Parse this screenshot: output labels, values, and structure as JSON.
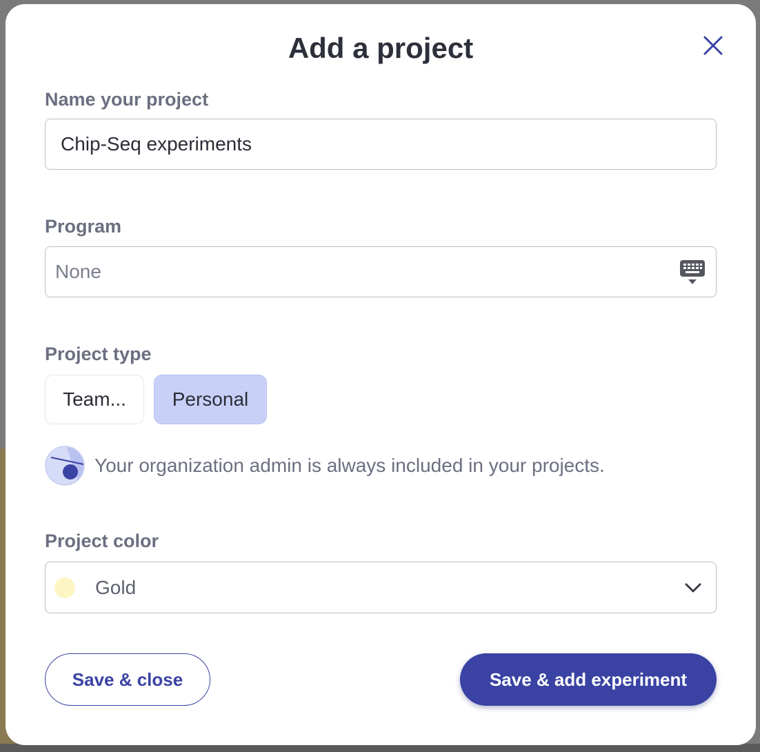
{
  "modal": {
    "title": "Add a project",
    "close_icon": "close-icon"
  },
  "name_field": {
    "label": "Name your project",
    "value": "Chip-Seq experiments"
  },
  "program_field": {
    "label": "Program",
    "placeholder": "None",
    "icon": "keyboard-dropdown-icon"
  },
  "project_type": {
    "label": "Project type",
    "options": [
      {
        "label": "Team...",
        "selected": false
      },
      {
        "label": "Personal",
        "selected": true
      }
    ]
  },
  "info": {
    "icon": "admin-info-icon",
    "text": "Your organization admin is always included in your projects."
  },
  "project_color": {
    "label": "Project color",
    "value": "Gold",
    "swatch_color": "#fdf6c3",
    "icon": "chevron-down-icon"
  },
  "actions": {
    "secondary_label": "Save & close",
    "primary_label": "Save & add experiment"
  },
  "colors": {
    "accent": "#3a43a3",
    "selected_bg": "#c9d0f8",
    "label_text": "#6b6f80"
  }
}
